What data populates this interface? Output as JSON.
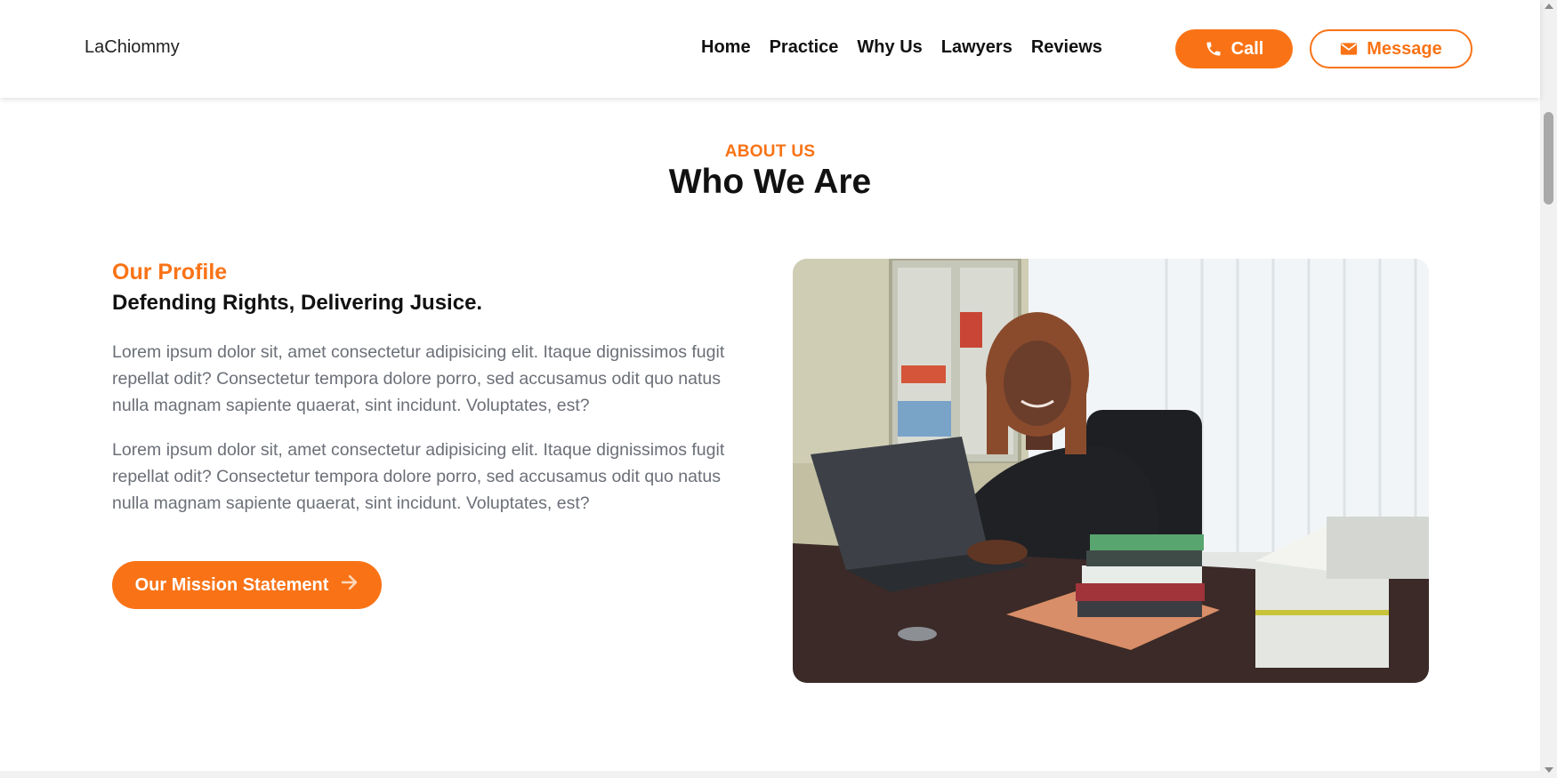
{
  "header": {
    "logo": "LaChiommy",
    "nav": [
      "Home",
      "Practice",
      "Why Us",
      "Lawyers",
      "Reviews"
    ],
    "call_label": "Call",
    "message_label": "Message"
  },
  "section": {
    "eyebrow": "ABOUT US",
    "title": "Who We Are"
  },
  "profile": {
    "label": "Our Profile",
    "heading": "Defending Rights, Delivering Jusice.",
    "paragraphs": [
      "Lorem ipsum dolor sit, amet consectetur adipisicing elit. Itaque dignissimos fugit repellat odit? Consectetur tempora dolore porro, sed accusamus odit quo natus nulla magnam sapiente quaerat, sint incidunt. Voluptates, est?",
      "Lorem ipsum dolor sit, amet consectetur adipisicing elit. Itaque dignissimos fugit repellat odit? Consectetur tempora dolore porro, sed accusamus odit quo natus nulla magnam sapiente quaerat, sint incidunt. Voluptates, est?"
    ],
    "cta_label": "Our Mission Statement"
  },
  "colors": {
    "accent": "#f97316",
    "text_dark": "#111111",
    "text_muted": "#6b6f77"
  },
  "icons": {
    "call": "phone-icon",
    "message": "envelope-icon",
    "cta": "arrow-right-icon",
    "scroll_up": "chevron-up-icon",
    "scroll_down": "chevron-down-icon"
  }
}
